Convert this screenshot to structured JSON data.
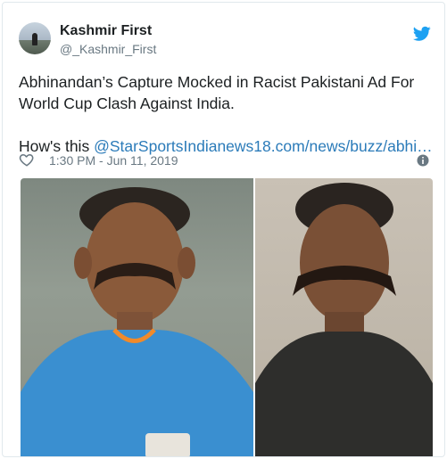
{
  "tweet": {
    "author_name": "Kashmir First",
    "author_handle": "@_Kashmir_First",
    "text_line": "Abhinandan’s Capture Mocked in Racist Pakistani Ad For World Cup Clash Against India.",
    "text_prefix": "How's this ",
    "link_text": "@StarSportsIndianews18.com/news/buzz/abhi…",
    "timestamp": "1:30 PM - Jun 11, 2019"
  },
  "icons": {
    "twitter_bird": "twitter-bird-icon",
    "like": "heart-icon",
    "info": "info-icon"
  },
  "colors": {
    "twitter_blue": "#1da1f2",
    "link": "#2b7bb9",
    "meta_gray": "#697882"
  }
}
